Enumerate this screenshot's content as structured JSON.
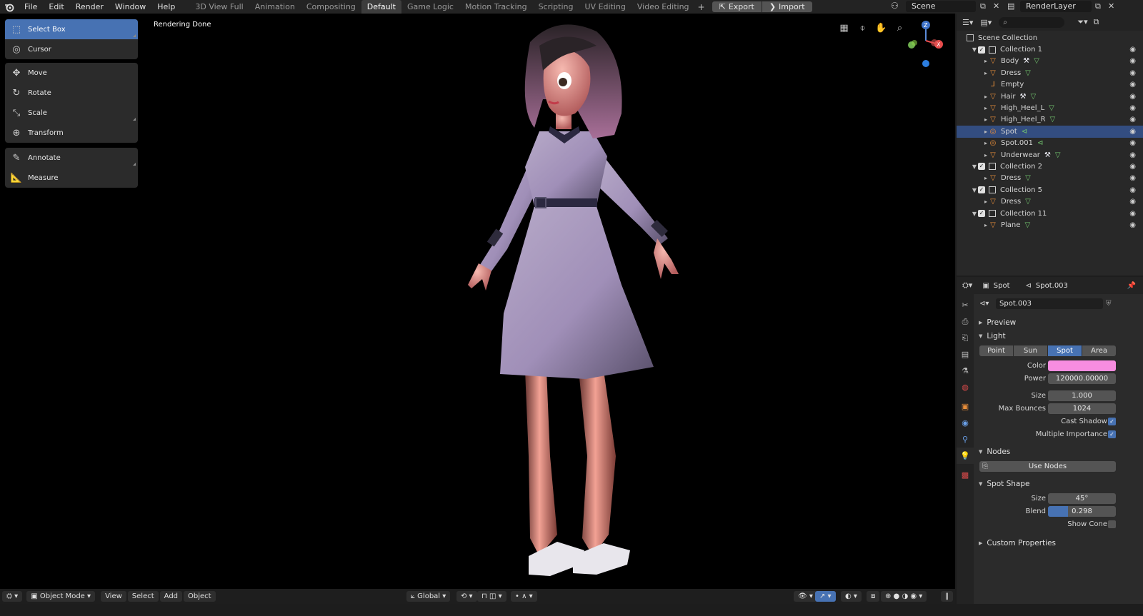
{
  "topbar": {
    "menus": [
      "File",
      "Edit",
      "Render",
      "Window",
      "Help"
    ],
    "workspaces": [
      "3D View Full",
      "Animation",
      "Compositing",
      "Default",
      "Game Logic",
      "Motion Tracking",
      "Scripting",
      "UV Editing",
      "Video Editing"
    ],
    "active_workspace": "Default",
    "export_label": "Export",
    "import_label": "Import",
    "scene": "Scene",
    "render_layer": "RenderLayer"
  },
  "viewport": {
    "status": "Rendering Done",
    "tools": {
      "select_box": "Select Box",
      "cursor": "Cursor",
      "move": "Move",
      "rotate": "Rotate",
      "scale": "Scale",
      "transform": "Transform",
      "annotate": "Annotate",
      "measure": "Measure"
    },
    "footer": {
      "mode": "Object Mode",
      "view": "View",
      "select": "Select",
      "add": "Add",
      "object": "Object",
      "orientation": "Global"
    },
    "gizmo": {
      "z": "Z",
      "x": "X"
    }
  },
  "outliner": {
    "root": "Scene Collection",
    "rows": [
      {
        "label": "Collection 1",
        "type": "collection",
        "depth": 0
      },
      {
        "label": "Body",
        "type": "mesh",
        "depth": 1,
        "mods": [
          "wrench",
          "mesh"
        ]
      },
      {
        "label": "Dress",
        "type": "mesh",
        "depth": 1,
        "mods": [
          "mesh"
        ]
      },
      {
        "label": "Empty",
        "type": "empty",
        "depth": 1,
        "mods": []
      },
      {
        "label": "Hair",
        "type": "mesh",
        "depth": 1,
        "mods": [
          "wrench",
          "mesh"
        ]
      },
      {
        "label": "High_Heel_L",
        "type": "mesh",
        "depth": 1,
        "mods": [
          "mesh"
        ]
      },
      {
        "label": "High_Heel_R",
        "type": "mesh",
        "depth": 1,
        "mods": [
          "mesh"
        ]
      },
      {
        "label": "Spot",
        "type": "light",
        "depth": 1,
        "mods": [
          "light"
        ],
        "selected": true
      },
      {
        "label": "Spot.001",
        "type": "light",
        "depth": 1,
        "mods": [
          "light"
        ]
      },
      {
        "label": "Underwear",
        "type": "mesh",
        "depth": 1,
        "mods": [
          "wrench",
          "mesh"
        ]
      },
      {
        "label": "Collection 2",
        "type": "collection",
        "depth": 0
      },
      {
        "label": "Dress",
        "type": "mesh",
        "depth": 1,
        "mods": [
          "mesh"
        ]
      },
      {
        "label": "Collection 5",
        "type": "collection",
        "depth": 0
      },
      {
        "label": "Dress",
        "type": "mesh",
        "depth": 1,
        "mods": [
          "mesh"
        ]
      },
      {
        "label": "Collection 11",
        "type": "collection",
        "depth": 0
      },
      {
        "label": "Plane",
        "type": "mesh",
        "depth": 1,
        "mods": [
          "mesh"
        ]
      }
    ]
  },
  "properties": {
    "object_name": "Spot",
    "data_name": "Spot.003",
    "datablock": "Spot.003",
    "sections": {
      "preview": "Preview",
      "light": "Light",
      "nodes": "Nodes",
      "spot_shape": "Spot Shape",
      "custom": "Custom Properties"
    },
    "light_types": [
      "Point",
      "Sun",
      "Spot",
      "Area"
    ],
    "active_light_type": "Spot",
    "color_label": "Color",
    "color_value": "#f78de0",
    "power_label": "Power",
    "power_value": "120000.00000",
    "size_label": "Size",
    "size_value": "1.000",
    "bounces_label": "Max Bounces",
    "bounces_value": "1024",
    "cast_shadow_label": "Cast Shadow",
    "multi_importance_label": "Multiple Importance",
    "use_nodes_label": "Use Nodes",
    "spot_size_label": "Size",
    "spot_size_value": "45°",
    "blend_label": "Blend",
    "blend_value": "0.298",
    "blend_fraction": 0.298,
    "show_cone_label": "Show Cone"
  },
  "colors": {
    "accent": "#4772b3",
    "selected_row": "#334d80",
    "object_orange": "#e88e3a",
    "modifier_green": "#72c46e",
    "modifier_blue": "#6aa0e8"
  }
}
